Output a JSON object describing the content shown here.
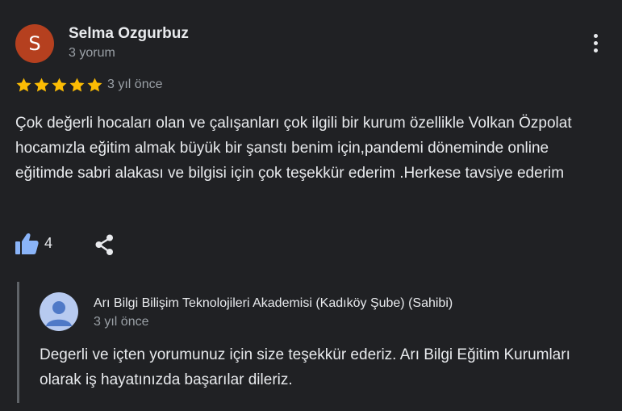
{
  "review": {
    "author": {
      "initial": "S",
      "name": "Selma Ozgurbuz",
      "meta": "3 yorum",
      "avatar_color": "#b5401f"
    },
    "menu_icon": "more-vert-icon",
    "rating": 5,
    "rating_max": 5,
    "star_color": "#fbbc04",
    "date": "3 yıl önce",
    "text": "Çok değerli hocaları olan ve çalışanları çok ilgili bir kurum özellikle Volkan Özpolat hocamızla eğitim almak büyük bir şanstı benim için,pandemi döneminde online eğitimde sabri alakası ve bilgisi için çok teşekkür ederim .Herkese tavsiye ederim",
    "actions": {
      "like_count": "4",
      "like_icon": "thumb-up-icon",
      "like_color": "#8ab4f8",
      "share_icon": "share-icon"
    }
  },
  "owner_reply": {
    "name": "Arı Bilgi Bilişim Teknolojileri Akademisi (Kadıköy Şube) (Sahibi)",
    "date": "3 yıl önce",
    "text": "Degerli ve içten yorumunuz için size teşekkür ederiz. Arı Bilgi Eğitim Kurumları olarak iş hayatınızda başarılar dileriz.",
    "avatar_icon": "default-user-avatar-icon"
  }
}
